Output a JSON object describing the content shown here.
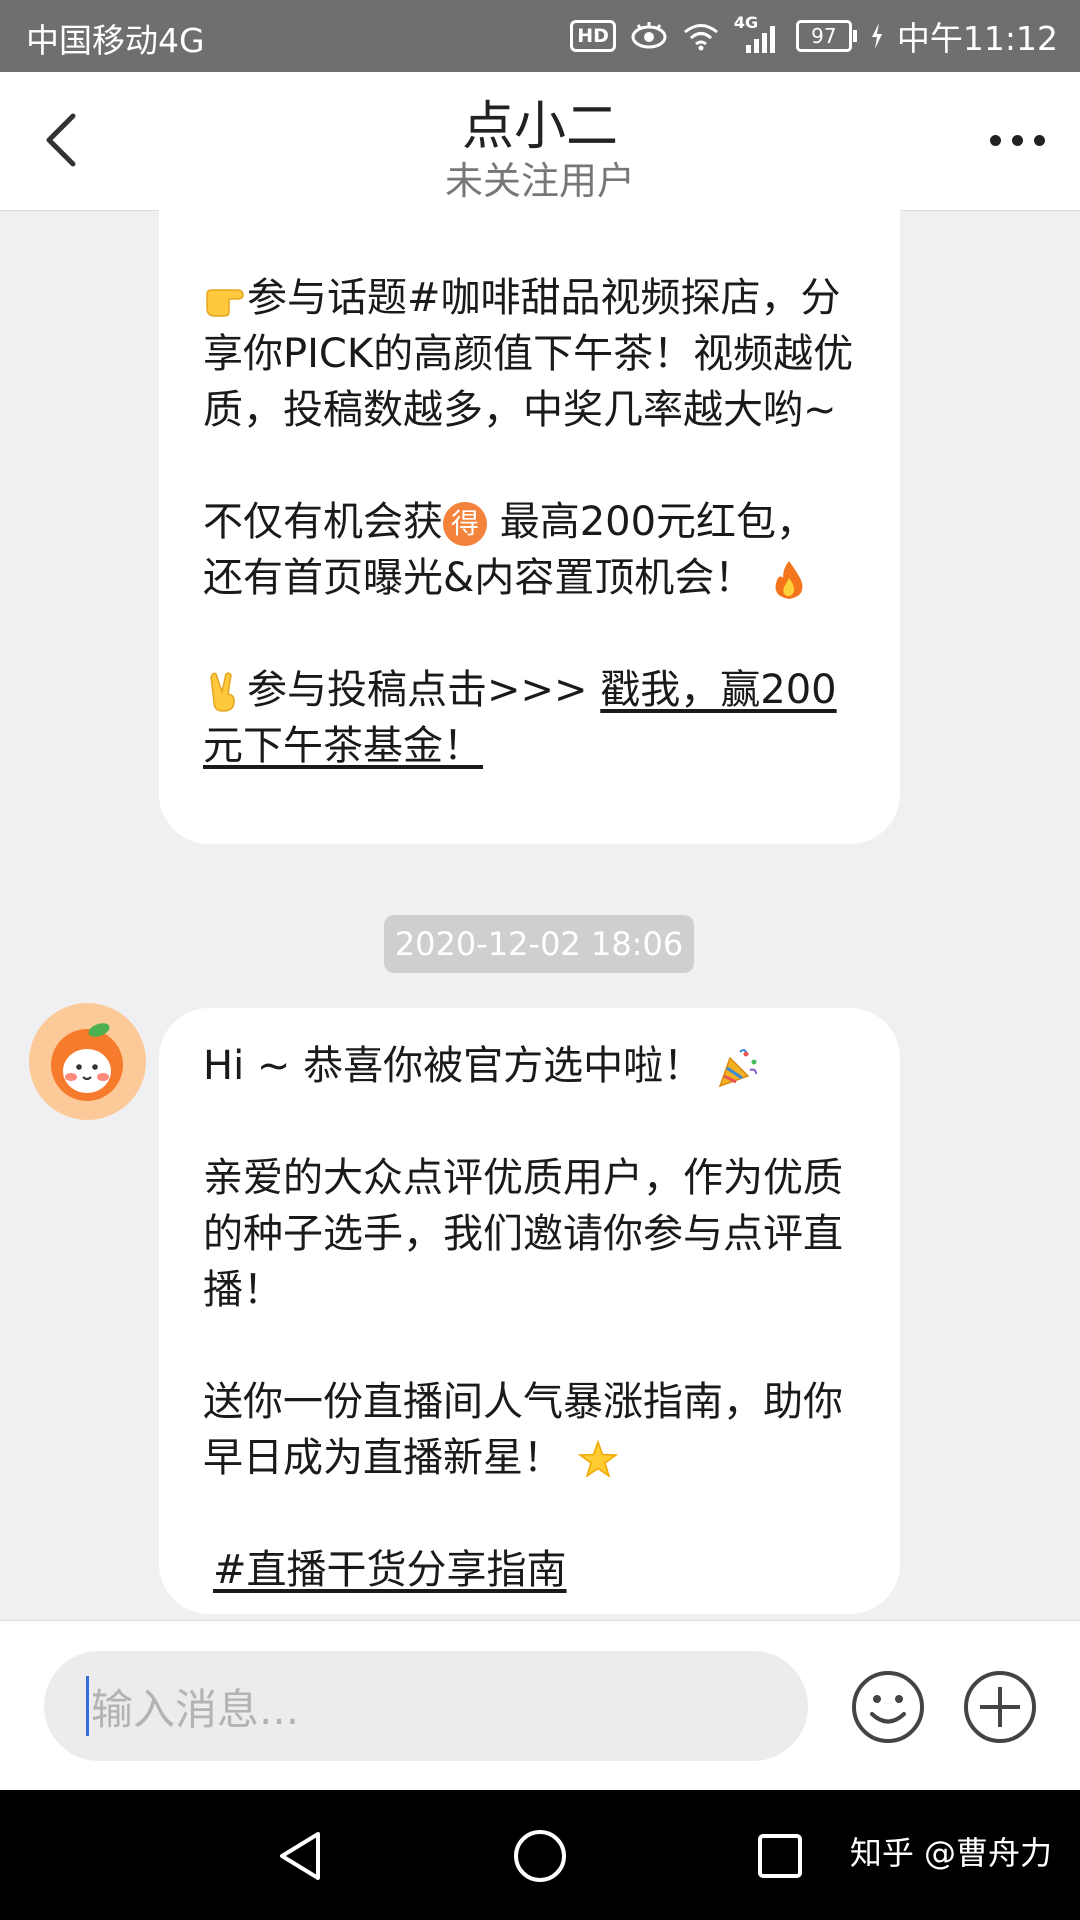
{
  "status_bar": {
    "carrier": "中国移动4G",
    "hd": "HD",
    "network": "4G",
    "battery": "97",
    "time": "中午11:12"
  },
  "header": {
    "title": "点小二",
    "subtitle": "未关注用户"
  },
  "messages": [
    {
      "paragraphs": [
        {
          "emoji": "backhand-pointing-right",
          "text": "参与话题#咖啡甜品视频探店，分享你PICK的高颜值下午茶！视频越优质，投稿数越多，中奖几率越大哟~"
        },
        {
          "text_before": "不仅有机会获",
          "emoji_mid": "得",
          "text_after": " 最高200元红包，还有首页曝光&内容置顶机会！",
          "emoji_end": "fire"
        },
        {
          "emoji": "victory-hand",
          "text": "参与投稿点击>>> ",
          "link": "戳我，赢200元下午茶基金！"
        }
      ]
    },
    {
      "timestamp": "2020-12-02 18:06",
      "paragraphs": [
        {
          "text": "Hi ~ 恭喜你被官方选中啦！",
          "emoji_end": "party-popper"
        },
        {
          "text": "亲爱的大众点评优质用户，作为优质的种子选手，我们邀请你参与点评直播！"
        },
        {
          "text": "送你一份直播间人气暴涨指南，助你早日成为直播新星！",
          "emoji_end": "glowing-star"
        },
        {
          "link": "#直播干货分享指南"
        }
      ]
    }
  ],
  "input": {
    "placeholder": "输入消息..."
  },
  "watermark": "知乎 @曹舟力",
  "colors": {
    "status_bar": "#6f6f6f",
    "chat_background": "#f0f0f2",
    "bubble": "#ffffff",
    "timestamp_bg": "#cfcfcf",
    "avatar_bg": "#fcc998",
    "caret": "#3070d8"
  }
}
